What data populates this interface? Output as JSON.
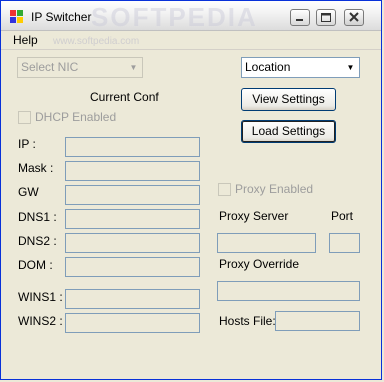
{
  "window": {
    "title": "IP Switcher",
    "watermark": "SOFTPEDIA",
    "watermark_url": "www.softpedia.com"
  },
  "menu": {
    "help": "Help"
  },
  "nic_select": {
    "value": "Select NIC"
  },
  "location_select": {
    "value": "Location"
  },
  "current_conf_label": "Current Conf",
  "buttons": {
    "view_settings": "View Settings",
    "load_settings": "Load Settings"
  },
  "dhcp_label": "DHCP Enabled",
  "fields": {
    "ip": "IP :",
    "mask": "Mask :",
    "gw": "GW",
    "dns1": "DNS1 :",
    "dns2": "DNS2 :",
    "dom": "DOM :",
    "wins1": "WINS1 :",
    "wins2": "WINS2 :"
  },
  "proxy": {
    "enabled_label": "Proxy Enabled",
    "server_label": "Proxy Server",
    "port_label": "Port",
    "override_label": "Proxy Override",
    "hosts_label": "Hosts File:"
  }
}
